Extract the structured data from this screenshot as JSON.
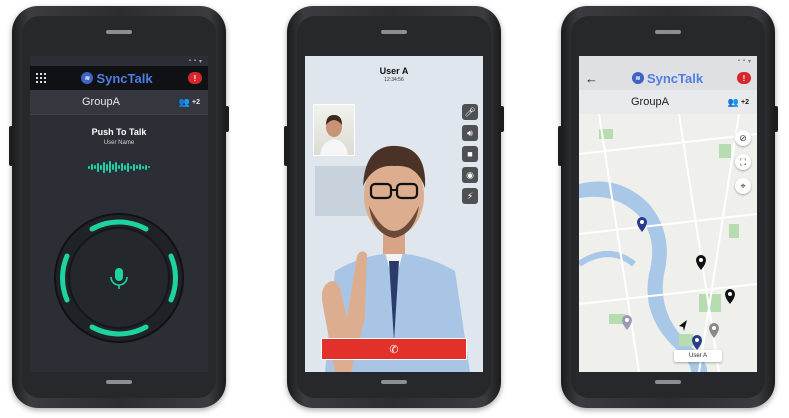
{
  "brand": {
    "name": "SyncTalk",
    "logo_icon": "waveform-logo-icon",
    "color": "#4f7de0"
  },
  "status_icons": [
    "signal-icon",
    "wifi-icon",
    "battery-icon"
  ],
  "ptt_screen": {
    "group_name": "GroupA",
    "member_count": "+2",
    "title": "Push To Talk",
    "user_name": "User Name",
    "accent_color": "#1ed3a0",
    "mic_icon": "microphone-icon"
  },
  "video_call_screen": {
    "caller": "User A",
    "call_time": "12:34:56",
    "controls": [
      "microphone-icon",
      "speaker-icon",
      "video-camera-icon",
      "camera-switch-icon",
      "flash-icon"
    ],
    "end_call_icon": "hang-up-icon",
    "end_call_color": "#e2302b"
  },
  "map_screen": {
    "group_name": "GroupA",
    "member_count": "+2",
    "marker_label": "User A",
    "map_controls": [
      "no-tracking-icon",
      "fullscreen-icon",
      "locate-icon"
    ]
  }
}
